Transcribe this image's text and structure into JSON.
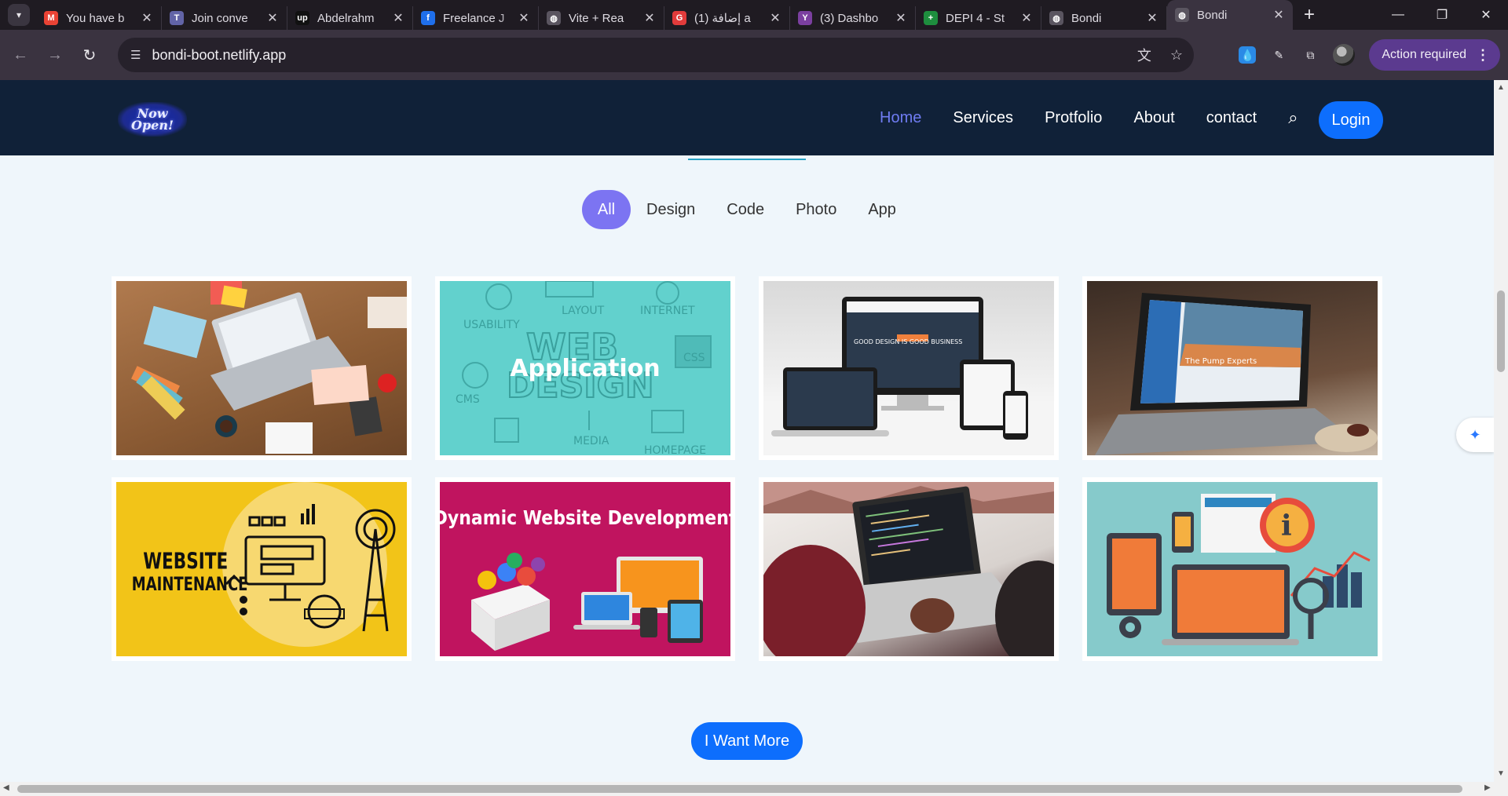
{
  "browser": {
    "tabs": [
      {
        "title": "You have b",
        "favicon": "gmail-icon",
        "color": "#ea4335",
        "glyph": "M"
      },
      {
        "title": "Join conve",
        "favicon": "teams-icon",
        "color": "#6264a7",
        "glyph": "T"
      },
      {
        "title": "Abdelrahm",
        "favicon": "upwork-icon",
        "color": "#111111",
        "glyph": "up"
      },
      {
        "title": "Freelance J",
        "favicon": "freelance-icon",
        "color": "#1f6feb",
        "glyph": "f"
      },
      {
        "title": "Vite + Rea",
        "favicon": "globe-icon",
        "color": "#5a5560",
        "glyph": "◍"
      },
      {
        "title": "(1) إضافة a",
        "favicon": "app-icon",
        "color": "#e23b3b",
        "glyph": "G"
      },
      {
        "title": "(3) Dashbo",
        "favicon": "yoast-icon",
        "color": "#7b3fa0",
        "glyph": "Y"
      },
      {
        "title": "DEPI 4 - St",
        "favicon": "sheets-icon",
        "color": "#1e8e3e",
        "glyph": "+"
      },
      {
        "title": "Bondi",
        "favicon": "globe-icon",
        "color": "#5a5560",
        "glyph": "◍"
      },
      {
        "title": "Bondi",
        "favicon": "globe-icon",
        "color": "#5a5560",
        "glyph": "◍",
        "active": true
      }
    ],
    "url": "bondi-boot.netlify.app",
    "action_required": "Action required"
  },
  "site": {
    "logo_line1": "Now",
    "logo_line2": "Open!",
    "nav": [
      "Home",
      "Services",
      "Protfolio",
      "About",
      "contact"
    ],
    "login": "Login"
  },
  "portfolio": {
    "filters": [
      "All",
      "Design",
      "Code",
      "Photo",
      "App"
    ],
    "active_filter": "All",
    "cards": [
      {
        "scene": "desk"
      },
      {
        "scene": "webdesign",
        "overlay": "Application"
      },
      {
        "scene": "devices",
        "screen_text": "GOOD DESIGN IS GOOD BUSINESS"
      },
      {
        "scene": "pump",
        "screen_text": "The Pump Experts"
      },
      {
        "scene": "maint",
        "heading_line1": "WEBSITE",
        "heading_line2": "MAINTENANCE"
      },
      {
        "scene": "dynamic",
        "heading": "Dynamic Website Development"
      },
      {
        "scene": "coding"
      },
      {
        "scene": "infog"
      }
    ],
    "more_button": "I Want More"
  }
}
